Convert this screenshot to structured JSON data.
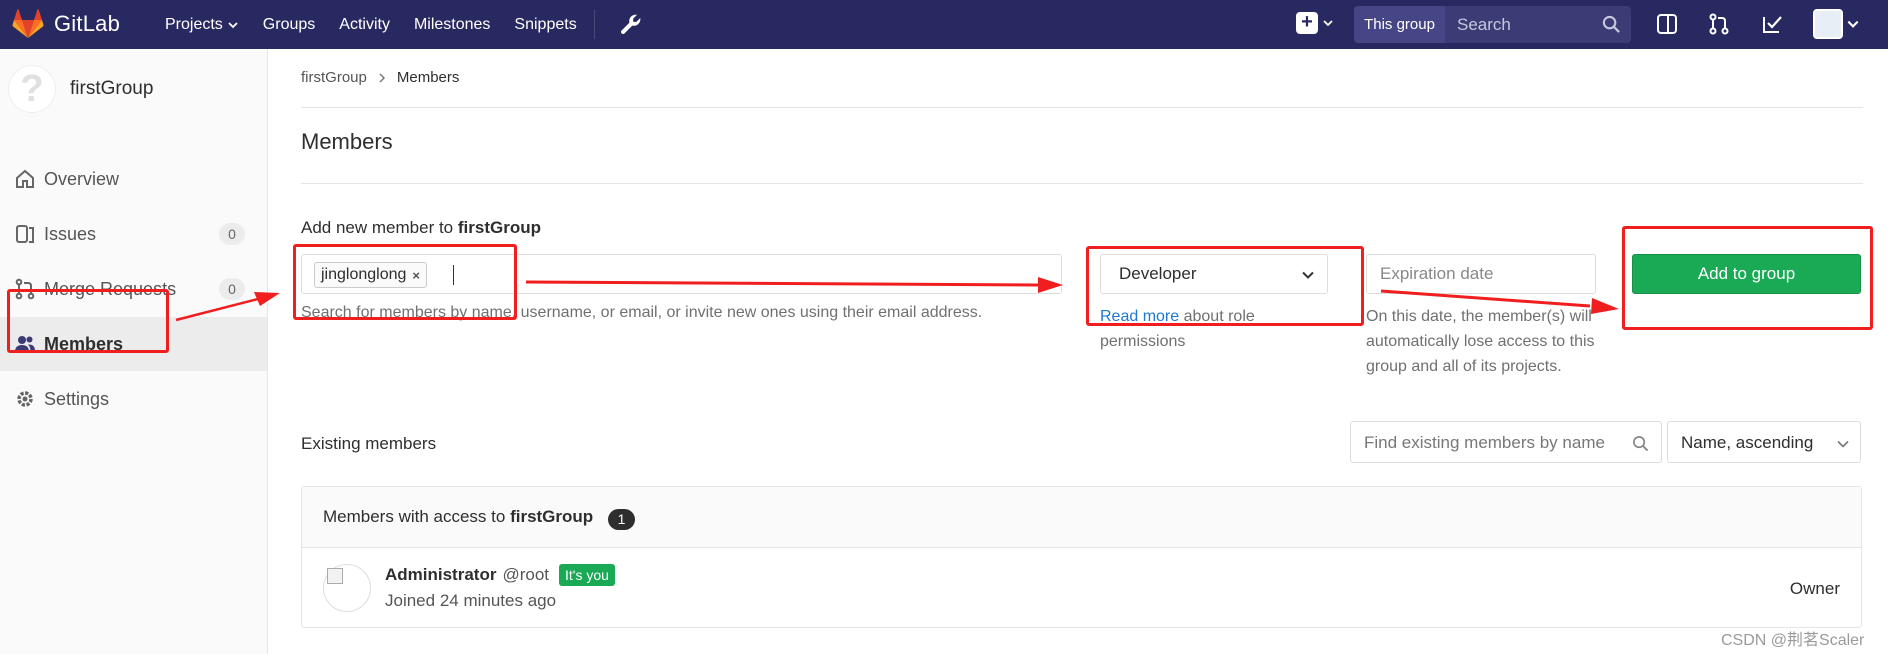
{
  "app": {
    "name": "GitLab",
    "brand_color": "#292961",
    "accent_color": "#1aaa55"
  },
  "topnav": {
    "links": [
      {
        "label": "Projects",
        "has_dropdown": true
      },
      {
        "label": "Groups"
      },
      {
        "label": "Activity"
      },
      {
        "label": "Milestones"
      },
      {
        "label": "Snippets"
      }
    ],
    "admin_icon": "wrench-icon",
    "scope_label": "This group",
    "search_placeholder": "Search",
    "icons": [
      "plus-square-icon",
      "sidebar-panel-icon",
      "merge-request-icon",
      "todo-check-icon",
      "user-avatar"
    ]
  },
  "sidebar": {
    "group_name": "firstGroup",
    "group_avatar_glyph": "?",
    "items": [
      {
        "label": "Overview",
        "icon": "home-icon"
      },
      {
        "label": "Issues",
        "icon": "issues-icon",
        "count": "0"
      },
      {
        "label": "Merge Requests",
        "icon": "merge-request-icon",
        "count": "0"
      },
      {
        "label": "Members",
        "icon": "users-icon",
        "active": true
      },
      {
        "label": "Settings",
        "icon": "gear-icon"
      }
    ]
  },
  "breadcrumb": {
    "items": [
      "firstGroup",
      "Members"
    ]
  },
  "page": {
    "title": "Members",
    "add_member": {
      "label_prefix": "Add new member to ",
      "group_name": "firstGroup",
      "selected_user": "jinglonglong",
      "token_remove_glyph": "×",
      "help_text": "Search for members by name, username, or email, or invite new ones using their email address.",
      "role_value": "Developer",
      "role_help_link": "Read more",
      "role_help_text": " about role permissions",
      "expiration_placeholder": "Expiration date",
      "expiration_help": "On this date, the member(s) will automatically lose access to this group and all of its projects.",
      "submit_label": "Add to group"
    },
    "existing": {
      "title": "Existing members",
      "find_placeholder": "Find existing members by name",
      "sort_value": "Name, ascending",
      "panel_prefix": "Members with access to ",
      "group_name": "firstGroup",
      "member_count": "1",
      "members": [
        {
          "name": "Administrator",
          "username": "@root",
          "badge": "It's you",
          "joined": "Joined 24 minutes ago",
          "role": "Owner"
        }
      ]
    }
  },
  "watermark": "CSDN @荆茗Scaler",
  "annotation_color": "#f01e1e"
}
